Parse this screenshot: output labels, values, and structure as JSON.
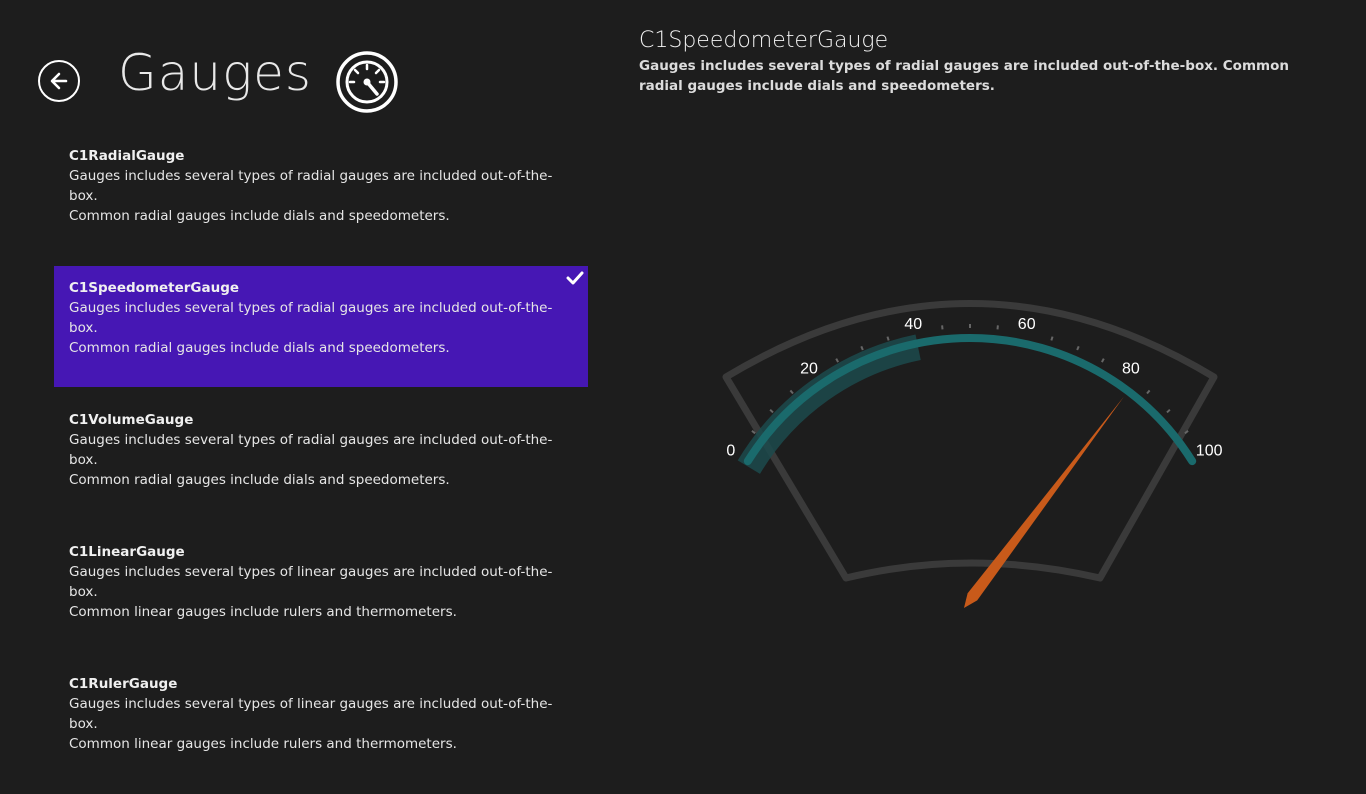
{
  "header": {
    "title": "Gauges",
    "back_icon": "back-arrow-icon",
    "app_icon": "speedometer-icon"
  },
  "list": {
    "items": [
      {
        "title": "C1RadialGauge",
        "desc1": "Gauges includes several types of radial gauges are included out-of-the-box.",
        "desc2": "Common radial gauges include dials and speedometers.",
        "selected": false
      },
      {
        "title": "C1SpeedometerGauge",
        "desc1": "Gauges includes several types of radial gauges are included out-of-the-box.",
        "desc2": "Common radial gauges include dials and speedometers.",
        "selected": true
      },
      {
        "title": "C1VolumeGauge",
        "desc1": "Gauges includes several types of radial gauges are included out-of-the-box.",
        "desc2": "Common radial gauges include dials and speedometers.",
        "selected": false
      },
      {
        "title": "C1LinearGauge",
        "desc1": "Gauges includes several types of linear gauges are included out-of-the-box.",
        "desc2": "Common linear gauges include rulers and thermometers.",
        "selected": false
      },
      {
        "title": "C1RulerGauge",
        "desc1": "Gauges includes several types of linear gauges are included out-of-the-box.",
        "desc2": "Common linear gauges include rulers and thermometers.",
        "selected": false
      }
    ]
  },
  "detail": {
    "title": "C1SpeedometerGauge",
    "description": "Gauges includes several types of radial gauges are included out-of-the-box. Common radial gauges include dials and speedometers."
  },
  "gauge": {
    "min": 0,
    "max": 100,
    "value": 82,
    "labels": [
      "0",
      "20",
      "40",
      "60",
      "80",
      "100"
    ],
    "range_end": 40
  },
  "colors": {
    "background": "#1d1d1d",
    "selection": "#4617b4",
    "gauge_arc": "#1a6a6c",
    "gauge_range": "#1c4a4c",
    "needle": "#c85a1a",
    "frame": "#3a3a3a"
  }
}
